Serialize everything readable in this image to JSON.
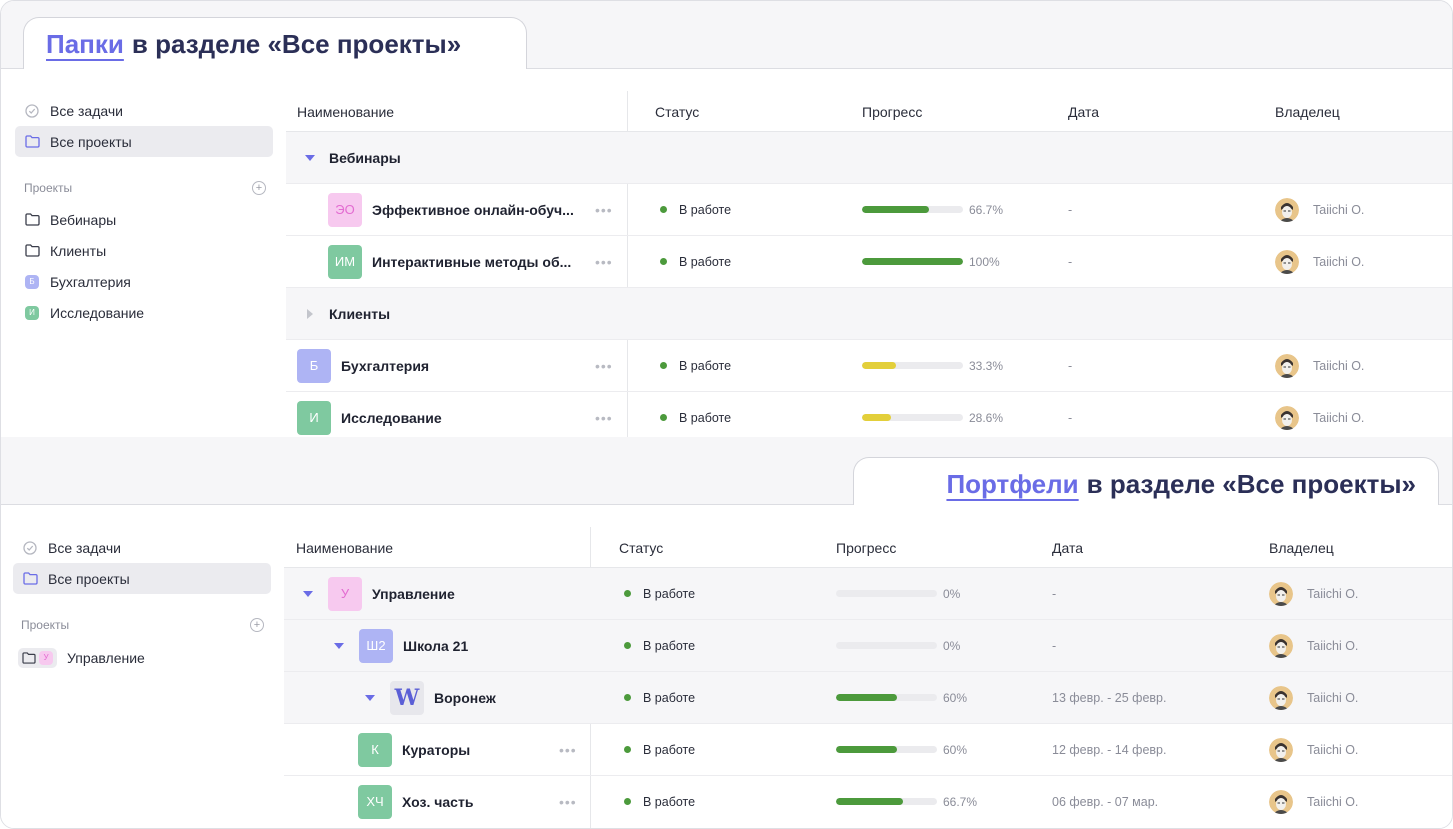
{
  "colors": {
    "accent": "#6a6ce6",
    "status_green": "#4c9a3c",
    "progress_green": "#4c9a3c",
    "progress_yellow": "#e3cf3a",
    "badge_pink_bg": "#f7c9ef",
    "badge_pink_fg": "#e36bd1",
    "badge_blue_bg": "#aeb4f4",
    "badge_green_bg": "#7fc9a0"
  },
  "folders_panel": {
    "tab": {
      "accent_word": "Папки",
      "rest": "в разделе «Все проекты»"
    },
    "sidebar": {
      "all_tasks": "Все задачи",
      "all_projects": "Все проекты",
      "projects_heading": "Проекты",
      "items": [
        {
          "label": "Вебинары",
          "icon": "folder-icon"
        },
        {
          "label": "Клиенты",
          "icon": "folder-icon"
        },
        {
          "label": "Бухгалтерия",
          "badge": "Б",
          "badge_color": "#aeb4f4"
        },
        {
          "label": "Исследование",
          "badge": "И",
          "badge_color": "#7fc9a0"
        }
      ]
    },
    "columns": {
      "name": "Наименование",
      "status": "Статус",
      "progress": "Прогресс",
      "date": "Дата",
      "owner": "Владелец"
    },
    "groups": [
      {
        "label": "Вебинары",
        "expanded": true
      },
      {
        "label": "Клиенты",
        "expanded": false
      }
    ],
    "rows": [
      {
        "badge": "ЭО",
        "name": "Эффективное онлайн-обуч...",
        "status": "В работе",
        "progress": 0.667,
        "progress_label": "66.7%",
        "date": "-",
        "owner": "Taiichi O."
      },
      {
        "badge": "ИМ",
        "name": "Интерактивные методы об...",
        "status": "В работе",
        "progress": 1.0,
        "progress_label": "100%",
        "date": "-",
        "owner": "Taiichi O."
      },
      {
        "badge": "Б",
        "name": "Бухгалтерия",
        "status": "В работе",
        "progress": 0.333,
        "progress_label": "33.3%",
        "date": "-",
        "owner": "Taiichi O."
      },
      {
        "badge": "И",
        "name": "Исследование",
        "status": "В работе",
        "progress": 0.286,
        "progress_label": "28.6%",
        "date": "-",
        "owner": "Taiichi O."
      }
    ]
  },
  "portfolios_panel": {
    "tab": {
      "accent_word": "Портфели",
      "rest": "в разделе «Все проекты»"
    },
    "sidebar": {
      "all_tasks": "Все задачи",
      "all_projects": "Все проекты",
      "projects_heading": "Проекты",
      "items": [
        {
          "label": "Управление",
          "badge": "У"
        }
      ]
    },
    "columns": {
      "name": "Наименование",
      "status": "Статус",
      "progress": "Прогресс",
      "date": "Дата",
      "owner": "Владелец"
    },
    "rows": [
      {
        "badge": "У",
        "name": "Управление",
        "status": "В работе",
        "progress": 0,
        "progress_label": "0%",
        "date": "-",
        "owner": "Taiichi O."
      },
      {
        "badge": "Ш2",
        "name": "Школа 21",
        "status": "В работе",
        "progress": 0,
        "progress_label": "0%",
        "date": "-",
        "owner": "Taiichi O."
      },
      {
        "badge": "W",
        "name": "Воронеж",
        "status": "В работе",
        "progress": 0.6,
        "progress_label": "60%",
        "date": "13 февр. - 25 февр.",
        "owner": "Taiichi O."
      },
      {
        "badge": "К",
        "name": "Кураторы",
        "status": "В работе",
        "progress": 0.6,
        "progress_label": "60%",
        "date": "12 февр. - 14 февр.",
        "owner": "Taiichi O."
      },
      {
        "badge": "ХЧ",
        "name": "Хоз. часть",
        "status": "В работе",
        "progress": 0.667,
        "progress_label": "66.7%",
        "date": "06 февр. - 07 мар.",
        "owner": "Taiichi O."
      }
    ]
  }
}
